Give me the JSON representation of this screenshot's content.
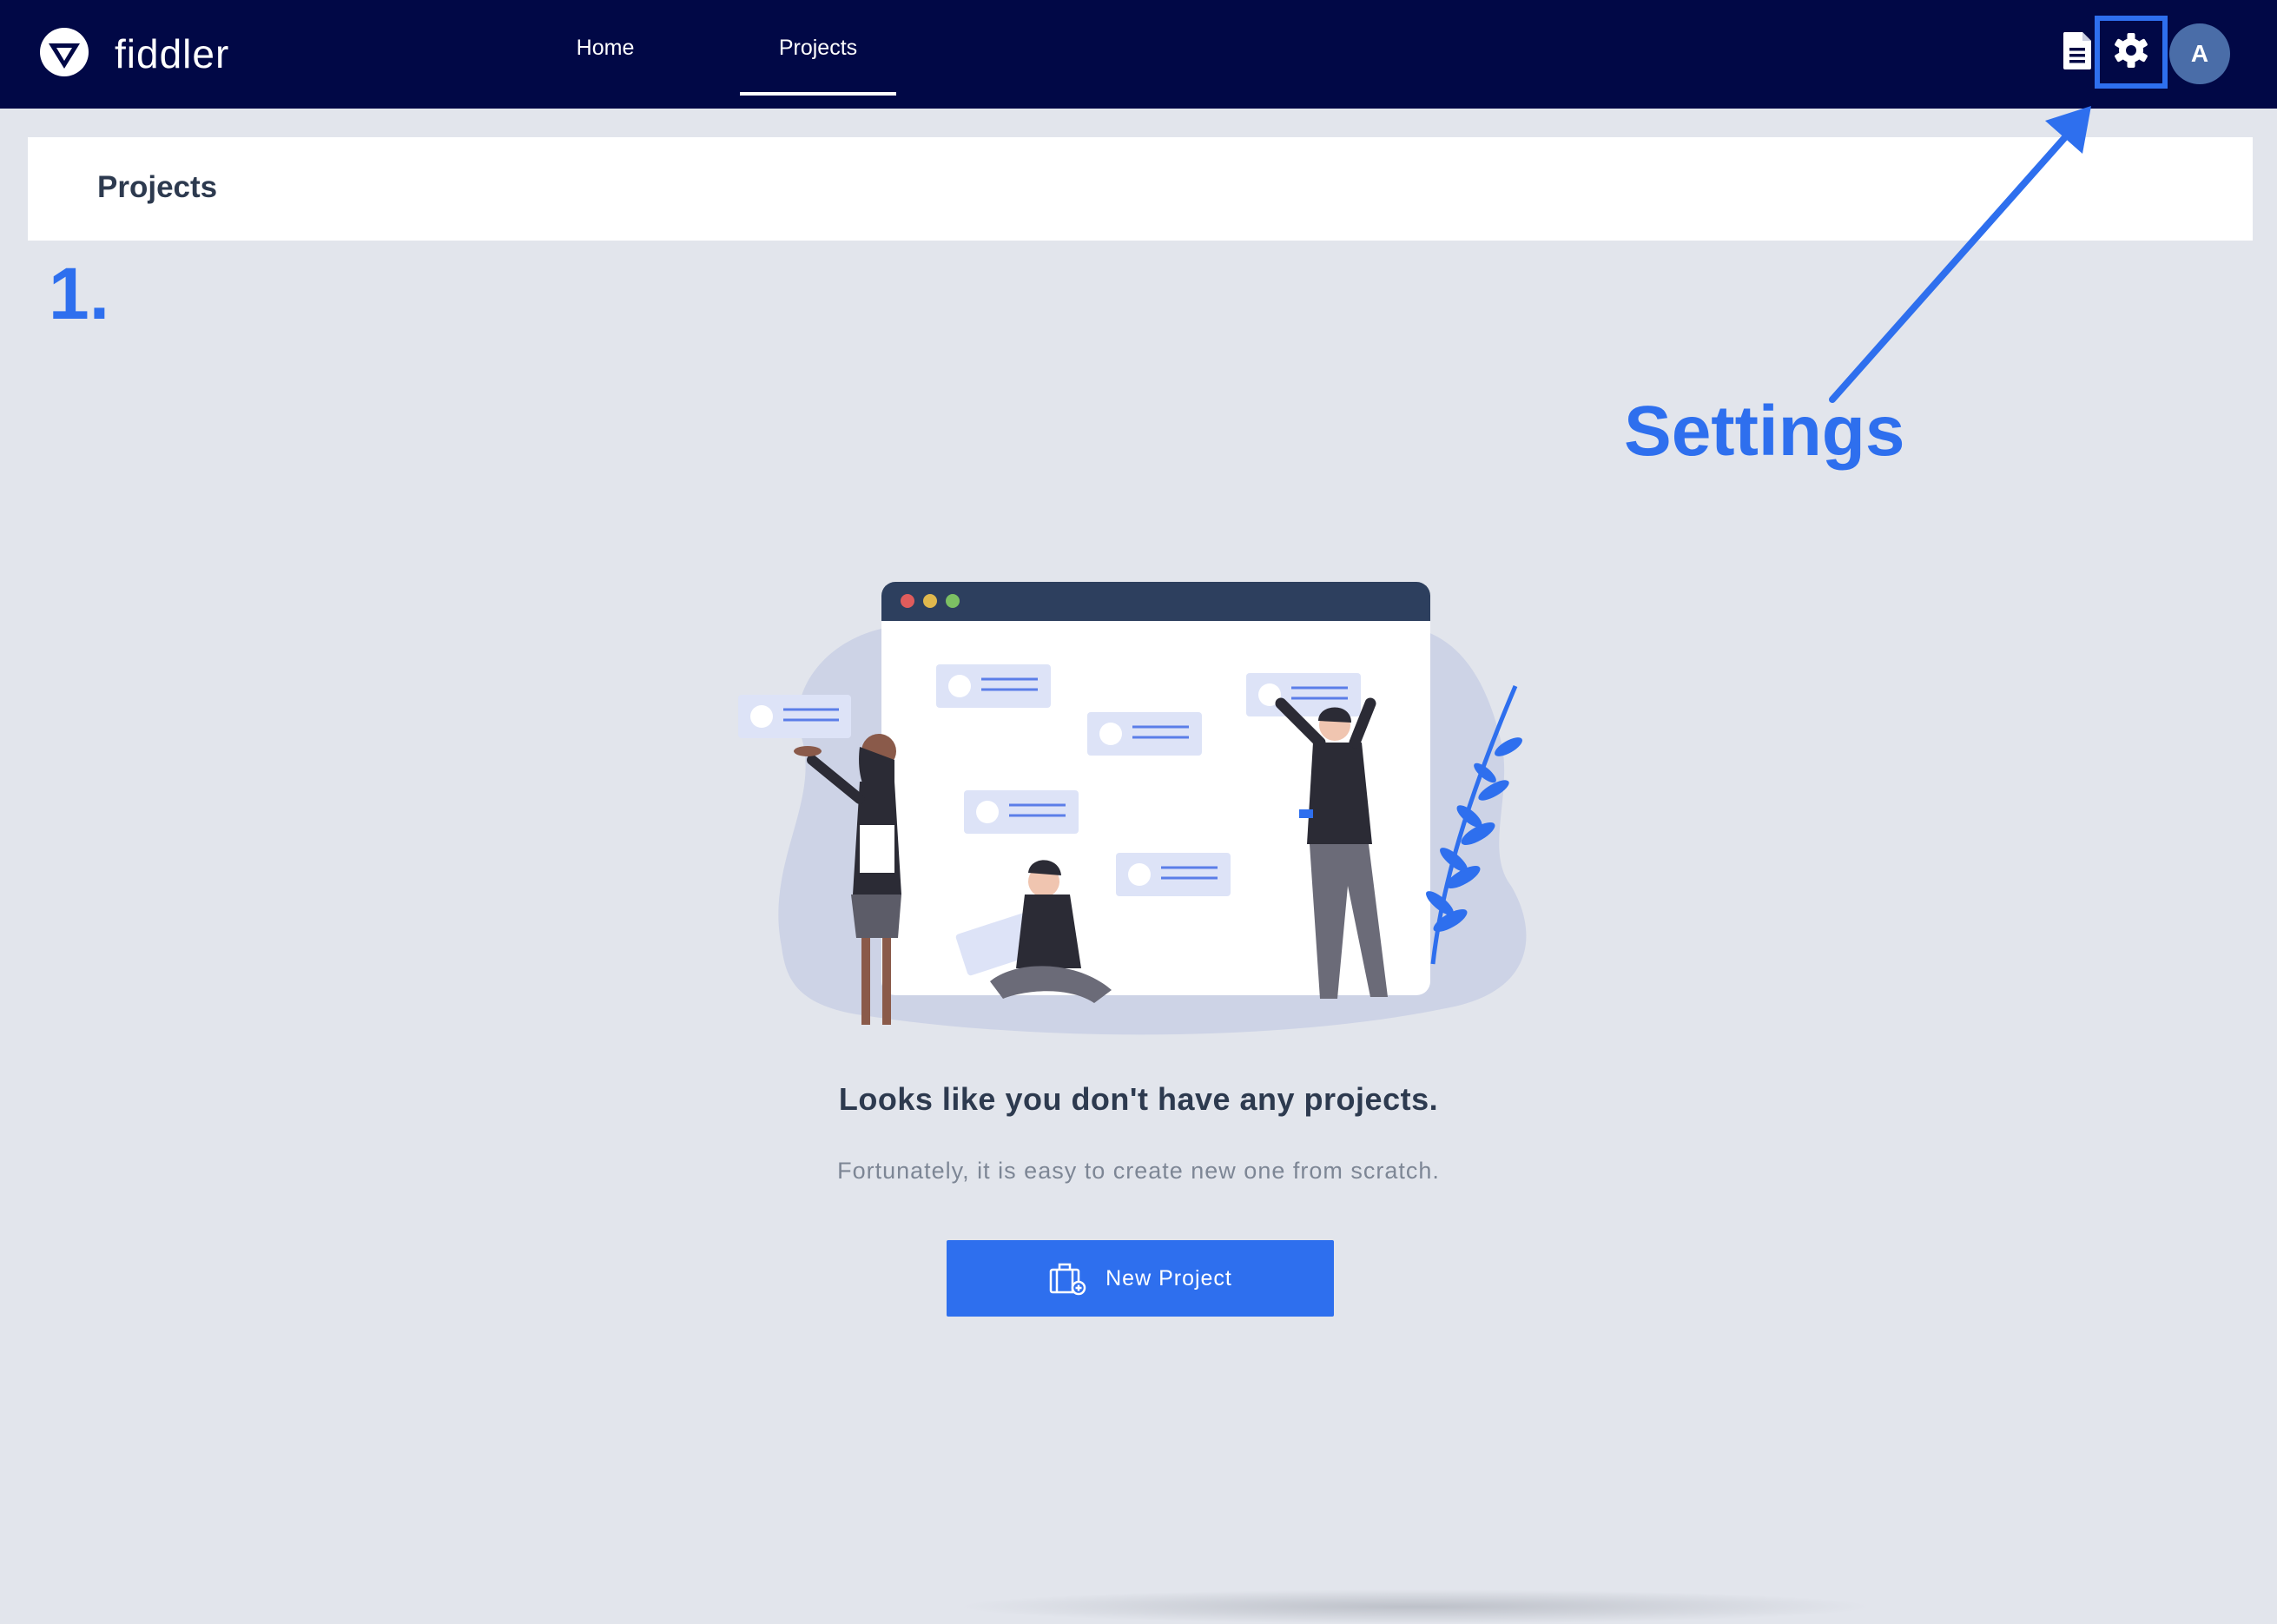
{
  "app": {
    "brand_name": "fiddler",
    "icons": {
      "logo": "fiddler-logo-icon",
      "docs": "document-icon",
      "settings": "gear-icon"
    }
  },
  "nav": {
    "tabs": [
      {
        "label": "Home",
        "active": false
      },
      {
        "label": "Projects",
        "active": true
      }
    ],
    "user_avatar_initial": "A"
  },
  "page": {
    "title": "Projects"
  },
  "annotations": {
    "step_number": "1.",
    "settings_callout": "Settings",
    "highlight_color": "#2e6fee"
  },
  "empty_state": {
    "title": "Looks like you don't have any projects.",
    "subtitle": "Fortunately, it is easy to create new one from scratch.",
    "new_project_label": "New Project",
    "new_project_icon": "briefcase-add-icon"
  },
  "colors": {
    "nav_bg": "#010846",
    "page_bg": "#e2e5ec",
    "accent": "#2e6fee",
    "title_text": "#2d3a4f"
  }
}
